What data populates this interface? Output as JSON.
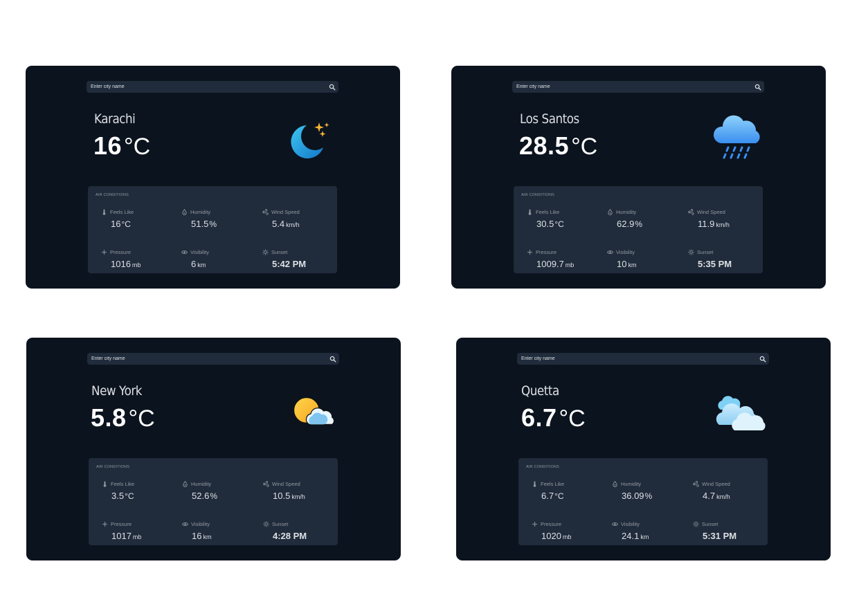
{
  "search": {
    "placeholder": "Enter city name"
  },
  "panel_title": "AIR CONDITIONS",
  "labels": {
    "feels_like": "Feels Like",
    "humidity": "Humidity",
    "wind_speed": "Wind Speed",
    "pressure": "Pressure",
    "visibility": "Visibility",
    "sunset": "Sunset"
  },
  "units": {
    "temp": "°C",
    "percent": "%",
    "wind": "km/h",
    "pressure": "mb",
    "visibility": "km"
  },
  "icons": {
    "search": "search-icon",
    "feels_like": "thermometer-icon",
    "humidity": "droplet-icon",
    "wind_speed": "wind-icon",
    "pressure": "pressure-icon",
    "visibility": "eye-icon",
    "sunset": "sun-icon"
  },
  "colors": {
    "page": "#ffffff",
    "card": "#0b131e",
    "panel": "#202b3b",
    "text": "#dde0e4",
    "muted": "#9399a2"
  },
  "cards": [
    {
      "city": "Karachi",
      "temp": "16",
      "icon": "moon-stars-icon",
      "feels_like": "16",
      "humidity": "51.5",
      "wind_speed": "5.4",
      "pressure": "1016",
      "visibility": "6",
      "sunset": "5:42 PM"
    },
    {
      "city": "Los Santos",
      "temp": "28.5",
      "icon": "rain-cloud-icon",
      "feels_like": "30.5",
      "humidity": "62.9",
      "wind_speed": "11.9",
      "pressure": "1009.7",
      "visibility": "10",
      "sunset": "5:35 PM"
    },
    {
      "city": "New York",
      "temp": "5.8",
      "icon": "sun-cloud-icon",
      "feels_like": "3.5",
      "humidity": "52.6",
      "wind_speed": "10.5",
      "pressure": "1017",
      "visibility": "16",
      "sunset": "4:28 PM"
    },
    {
      "city": "Quetta",
      "temp": "6.7",
      "icon": "cloudy-icon",
      "feels_like": "6.7",
      "humidity": "36.09",
      "wind_speed": "4.7",
      "pressure": "1020",
      "visibility": "24.1",
      "sunset": "5:31 PM"
    }
  ]
}
